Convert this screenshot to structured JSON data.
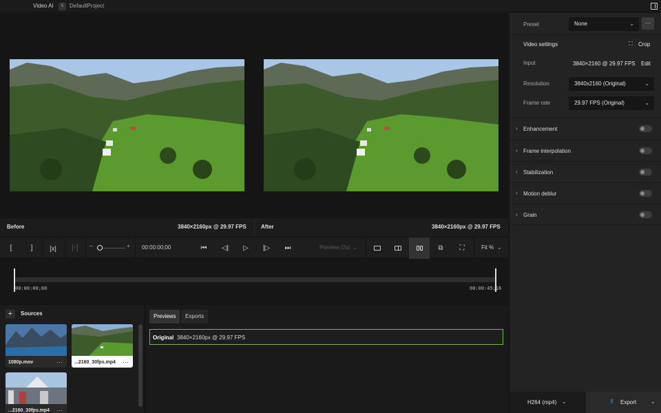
{
  "app": {
    "name": "Video AI",
    "badge": "5",
    "project": "DefaultProject"
  },
  "viewer": {
    "before_label": "Before",
    "before_info": "3840×2160px @ 29.97 FPS",
    "after_label": "After",
    "after_info": "3840×2160px @ 29.97 FPS"
  },
  "controls": {
    "mark_in": "[",
    "mark_out": "]",
    "clear_marks": "[x]",
    "zoom_minus": "–",
    "zoom_plus": "+",
    "timecode": "00:00:00;00",
    "preview": "Preview (2s)",
    "fit": "Fit %"
  },
  "timeline": {
    "start": "00:00:00;00",
    "end": "00:00:45;16"
  },
  "sources": {
    "title": "Sources",
    "items": [
      {
        "name": "1080p.mov"
      },
      {
        "name": "...2160_30fps.mp4"
      },
      {
        "name": "...2160_30fps.mp4"
      }
    ]
  },
  "previews": {
    "tabs": [
      "Previews",
      "Exports"
    ],
    "row_label": "Original",
    "row_info": "3840×2160px @ 29.97 FPS"
  },
  "settings": {
    "preset_label": "Preset",
    "preset_value": "None",
    "video_settings": "Video settings",
    "crop": "Crop",
    "input_label": "Input",
    "input_value": "3840×2160 @ 29.97 FPS",
    "edit": "Edit",
    "resolution_label": "Resolution",
    "resolution_value": "3840x2160 (Original)",
    "framerate_label": "Frame rate",
    "framerate_value": "29.97 FPS (Original)",
    "sections": [
      "Enhancement",
      "Frame interpolation",
      "Stabilization",
      "Motion deblur",
      "Grain"
    ]
  },
  "export": {
    "format": "H264 (mp4)",
    "label": "Export"
  }
}
